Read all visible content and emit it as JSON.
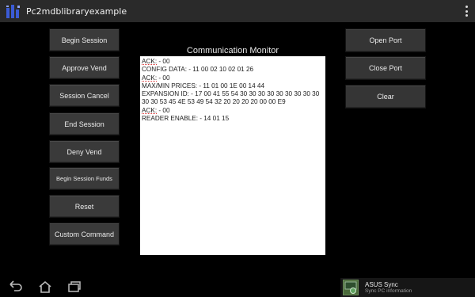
{
  "app": {
    "title": "Pc2mdblibraryexample",
    "icon": "app-logo-icon"
  },
  "left_buttons": [
    {
      "label": "Begin Session"
    },
    {
      "label": "Approve Vend"
    },
    {
      "label": "Session Cancel"
    },
    {
      "label": "End Session"
    },
    {
      "label": "Deny Vend"
    },
    {
      "label": "Begin Session Funds"
    },
    {
      "label": "Reset"
    },
    {
      "label": "Custom Command"
    }
  ],
  "right_buttons": [
    {
      "label": "Open Port"
    },
    {
      "label": "Close Port"
    },
    {
      "label": "Clear"
    }
  ],
  "monitor": {
    "title": "Communication Monitor",
    "lines": [
      {
        "keyword": "ACK:",
        "rest": " - 00"
      },
      {
        "keyword": "",
        "rest": " CONFIG DATA: - 11 00 02 10 02 01 26"
      },
      {
        "keyword": "ACK:",
        "rest": " - 00"
      },
      {
        "keyword": "",
        "rest": " MAX/MIN PRICES:  - 11 01 00 1E 00 14 44"
      },
      {
        "keyword": "",
        "rest": " EXPANSION ID:  - 17 00 41 55 54 30 30 30 30 30 30 30 30 30 30 30 53 45 4E 53 49 54 32 20 20 20 20 00 00 E9"
      },
      {
        "keyword": "ACK:",
        "rest": " - 00"
      },
      {
        "keyword": "",
        "rest": " READER ENABLE:  - 14 01 15"
      }
    ]
  },
  "navigation": {
    "back": "back-icon",
    "home": "home-icon",
    "recents": "recent-apps-icon"
  },
  "notification": {
    "title": "ASUS Sync",
    "subtitle": "Sync PC information",
    "icon": "asus-sync-icon"
  },
  "colors": {
    "background": "#000000",
    "button": "#3a3a3a",
    "monitor_bg": "#ffffff",
    "underline": "#dd3333"
  }
}
